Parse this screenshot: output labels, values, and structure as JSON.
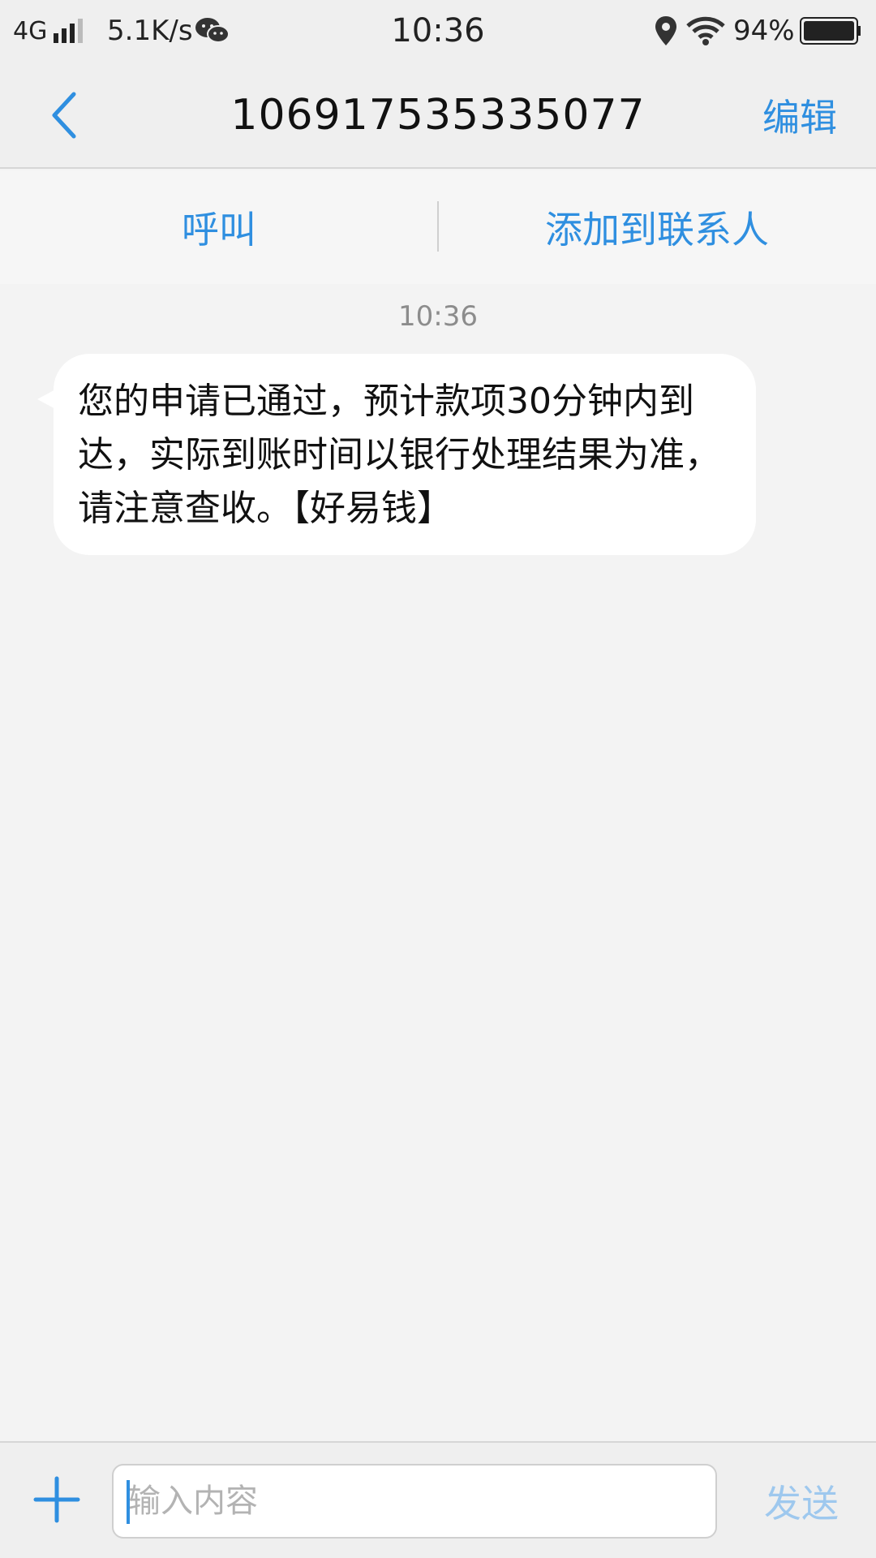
{
  "status_bar": {
    "network": "4G",
    "speed": "5.1K/s",
    "time": "10:36",
    "battery": "94%",
    "icons": [
      "signal-icon",
      "wechat-icon",
      "location-icon",
      "wifi-icon",
      "battery-icon"
    ]
  },
  "header": {
    "title": "106917535335077",
    "edit_label": "编辑"
  },
  "actions": {
    "call_label": "呼叫",
    "add_contact_label": "添加到联系人"
  },
  "messages": [
    {
      "time": "10:36",
      "text": "您的申请已通过，预计款项30分钟内到达，实际到账时间以银行处理结果为准，请注意查收。【好易钱】"
    }
  ],
  "composer": {
    "placeholder": "输入内容",
    "send_label": "发送"
  },
  "colors": {
    "accent": "#2f8fe0",
    "send_disabled": "#9ec8ee",
    "background": "#f3f3f3"
  }
}
